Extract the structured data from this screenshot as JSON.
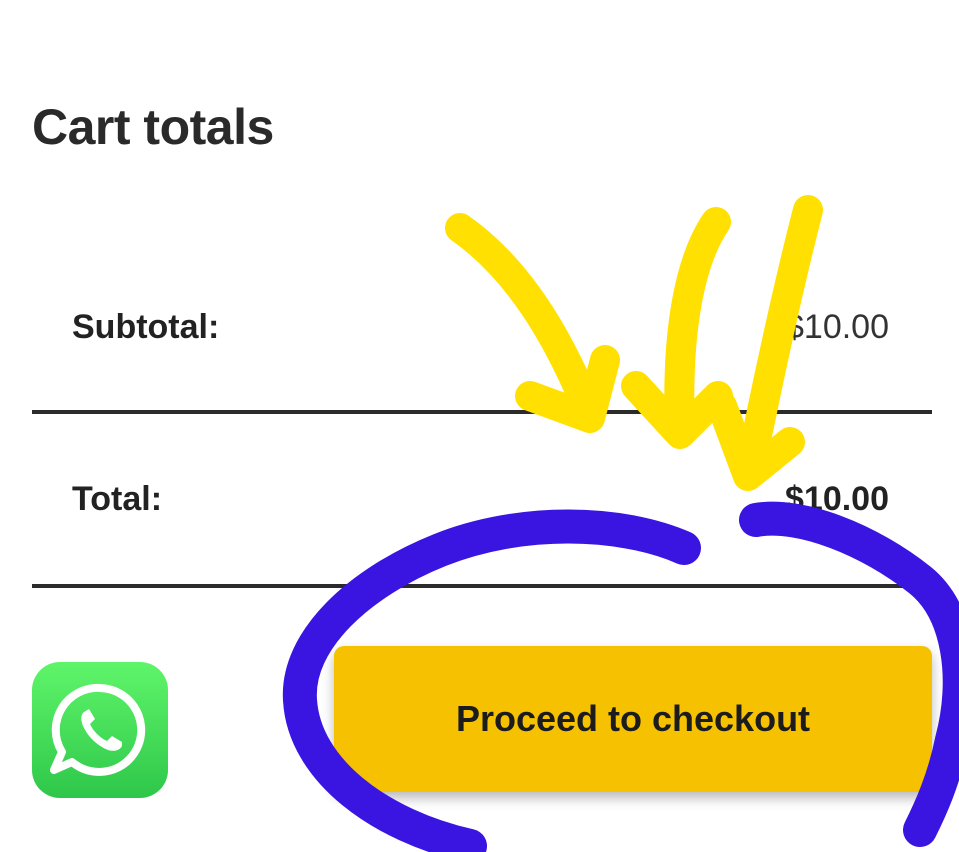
{
  "cart": {
    "title": "Cart totals",
    "subtotal_label": "Subtotal:",
    "subtotal_value": "$10.00",
    "total_label": "Total:",
    "total_value": "$10.00",
    "checkout_label": "Proceed to checkout"
  },
  "colors": {
    "button": "#f5c100",
    "whatsapp": "#3fd35a",
    "arrow_annotation": "#ffe000",
    "circle_annotation": "#3a14e0"
  },
  "icons": {
    "whatsapp": "whatsapp-icon"
  }
}
